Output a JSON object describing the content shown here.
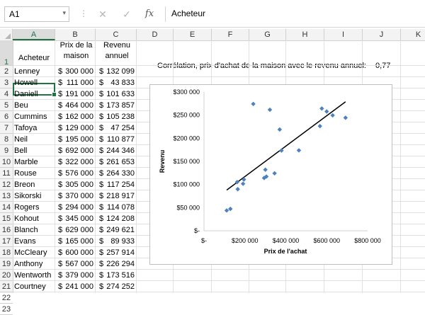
{
  "formula_bar": {
    "name_box": "A1",
    "name_box_arrow": "▾",
    "separator": "⋮",
    "cancel_icon": "✕",
    "enter_icon": "✓",
    "fx_label": "fx",
    "content": "Acheteur"
  },
  "columns": [
    "A",
    "B",
    "C",
    "D",
    "E",
    "F",
    "G",
    "H",
    "I",
    "J",
    "K"
  ],
  "rows": [
    "1",
    "2",
    "3",
    "4",
    "5",
    "6",
    "7",
    "8",
    "9",
    "10",
    "11",
    "12",
    "13",
    "14",
    "15",
    "16",
    "17",
    "18",
    "19",
    "20",
    "21",
    "22",
    "23"
  ],
  "table": {
    "headers": {
      "a": "Acheteur",
      "b_line1": "Prix de la",
      "b_line2": "maison",
      "c_line1": "Revenu",
      "c_line2": "annuel"
    },
    "currency": "$",
    "data": [
      {
        "name": "Lenney",
        "price": "300 000",
        "income": "132 099"
      },
      {
        "name": "Howell",
        "price": "111 000",
        "income": "43 833"
      },
      {
        "name": "Daniell",
        "price": "191 000",
        "income": "101 633"
      },
      {
        "name": "Beu",
        "price": "464 000",
        "income": "173 857"
      },
      {
        "name": "Cummins",
        "price": "162 000",
        "income": "105 238"
      },
      {
        "name": "Tafoya",
        "price": "129 000",
        "income": "47 254"
      },
      {
        "name": "Neil",
        "price": "195 000",
        "income": "110 877"
      },
      {
        "name": "Bell",
        "price": "692 000",
        "income": "244 346"
      },
      {
        "name": "Marble",
        "price": "322 000",
        "income": "261 653"
      },
      {
        "name": "Rouse",
        "price": "576 000",
        "income": "264 330"
      },
      {
        "name": "Breon",
        "price": "305 000",
        "income": "117 254"
      },
      {
        "name": "Sikorski",
        "price": "370 000",
        "income": "218 917"
      },
      {
        "name": "Rogers",
        "price": "294 000",
        "income": "114 078"
      },
      {
        "name": "Kohout",
        "price": "345 000",
        "income": "124 208"
      },
      {
        "name": "Blanch",
        "price": "629 000",
        "income": "249 621"
      },
      {
        "name": "Evans",
        "price": "165 000",
        "income": "89 933"
      },
      {
        "name": "McCleary",
        "price": "600 000",
        "income": "257 914"
      },
      {
        "name": "Anthony",
        "price": "567 000",
        "income": "226 294"
      },
      {
        "name": "Wentworth",
        "price": "379 000",
        "income": "173 516"
      },
      {
        "name": "Courtney",
        "price": "241 000",
        "income": "274 252"
      }
    ]
  },
  "correlation": {
    "label": "Corrélation, prix d'achat de la maison avec le revenu annuel:",
    "value": "0,77"
  },
  "chart_data": {
    "type": "scatter",
    "xlabel": "Prix de l'achat",
    "ylabel": "Revenu",
    "xlim": [
      0,
      800000
    ],
    "ylim": [
      0,
      300000
    ],
    "x_ticks": [
      {
        "value": 0,
        "label": "$-"
      },
      {
        "value": 200000,
        "label": "$200 000"
      },
      {
        "value": 400000,
        "label": "$400 000"
      },
      {
        "value": 600000,
        "label": "$600 000"
      },
      {
        "value": 800000,
        "label": "$800 000"
      }
    ],
    "y_ticks": [
      {
        "value": 0,
        "label": "$-"
      },
      {
        "value": 50000,
        "label": "$50 000"
      },
      {
        "value": 100000,
        "label": "$100 000"
      },
      {
        "value": 150000,
        "label": "$150 000"
      },
      {
        "value": 200000,
        "label": "$200 000"
      },
      {
        "value": 250000,
        "label": "$250 000"
      },
      {
        "value": 300000,
        "label": "$300 000"
      }
    ],
    "points": [
      {
        "x": 300000,
        "y": 132099
      },
      {
        "x": 111000,
        "y": 43833
      },
      {
        "x": 191000,
        "y": 101633
      },
      {
        "x": 464000,
        "y": 173857
      },
      {
        "x": 162000,
        "y": 105238
      },
      {
        "x": 129000,
        "y": 47254
      },
      {
        "x": 195000,
        "y": 110877
      },
      {
        "x": 692000,
        "y": 244346
      },
      {
        "x": 322000,
        "y": 261653
      },
      {
        "x": 576000,
        "y": 264330
      },
      {
        "x": 305000,
        "y": 117254
      },
      {
        "x": 370000,
        "y": 218917
      },
      {
        "x": 294000,
        "y": 114078
      },
      {
        "x": 345000,
        "y": 124208
      },
      {
        "x": 629000,
        "y": 249621
      },
      {
        "x": 165000,
        "y": 89933
      },
      {
        "x": 600000,
        "y": 257914
      },
      {
        "x": 567000,
        "y": 226294
      },
      {
        "x": 379000,
        "y": 173516
      },
      {
        "x": 241000,
        "y": 274252
      }
    ],
    "trendline": {
      "x1": 111000,
      "y1": 88000,
      "x2": 692000,
      "y2": 279000
    },
    "marker_color": "#4f81bd",
    "trendline_color": "#000000",
    "grid": false
  },
  "colors": {
    "accent": "#217346"
  }
}
